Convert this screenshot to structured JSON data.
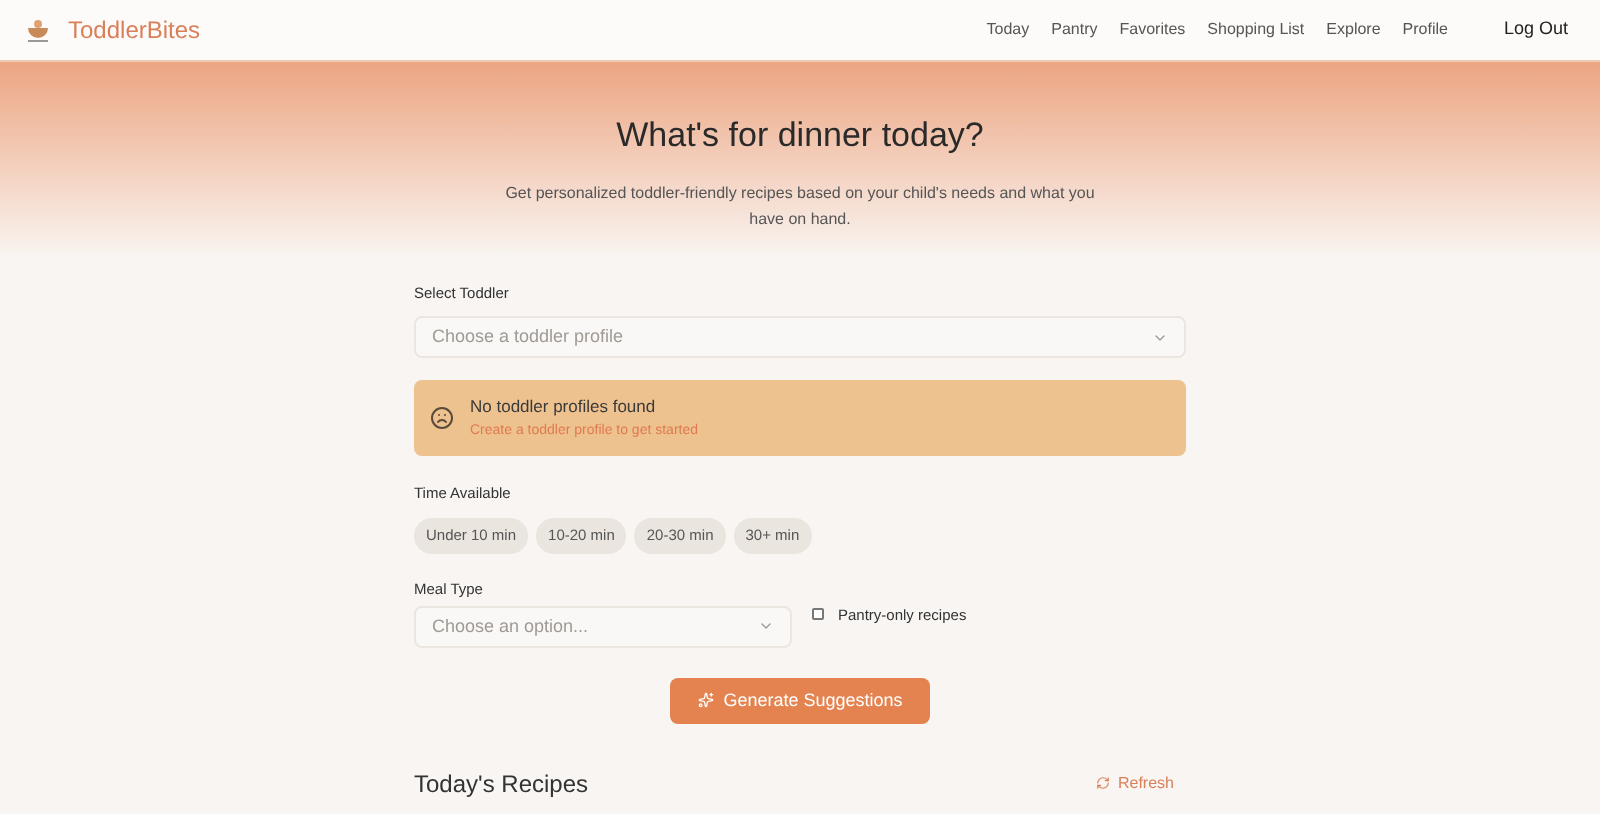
{
  "header": {
    "brand": "ToddlerBites",
    "nav": [
      {
        "label": "Today",
        "selected": false
      },
      {
        "label": "Pantry",
        "selected": false
      },
      {
        "label": "Favorites",
        "selected": false
      },
      {
        "label": "Shopping List",
        "selected": false
      },
      {
        "label": "Explore",
        "selected": false
      },
      {
        "label": "Profile",
        "selected": false
      }
    ],
    "logout": "Log Out"
  },
  "hero": {
    "title": "What's for dinner today?",
    "subtitle": "Get personalized toddler-friendly recipes based on your child's needs and what you have on hand."
  },
  "toddler": {
    "label": "Select Toddler",
    "placeholder": "Choose a toddler profile"
  },
  "notice": {
    "title": "No toddler profiles found",
    "link": "Create a toddler profile to get started"
  },
  "time": {
    "label": "Time Available",
    "options": [
      {
        "label": "Under 10 min",
        "selected": false
      },
      {
        "label": "10-20 min",
        "selected": false
      },
      {
        "label": "20-30 min",
        "selected": false
      },
      {
        "label": "30+ min",
        "selected": false
      }
    ]
  },
  "meal": {
    "label": "Meal Type",
    "placeholder": "Choose an option..."
  },
  "pantry_only": {
    "label": "Pantry-only recipes",
    "checked": false
  },
  "generate": "Generate Suggestions",
  "recipes": {
    "title": "Today's Recipes",
    "refresh": "Refresh"
  }
}
